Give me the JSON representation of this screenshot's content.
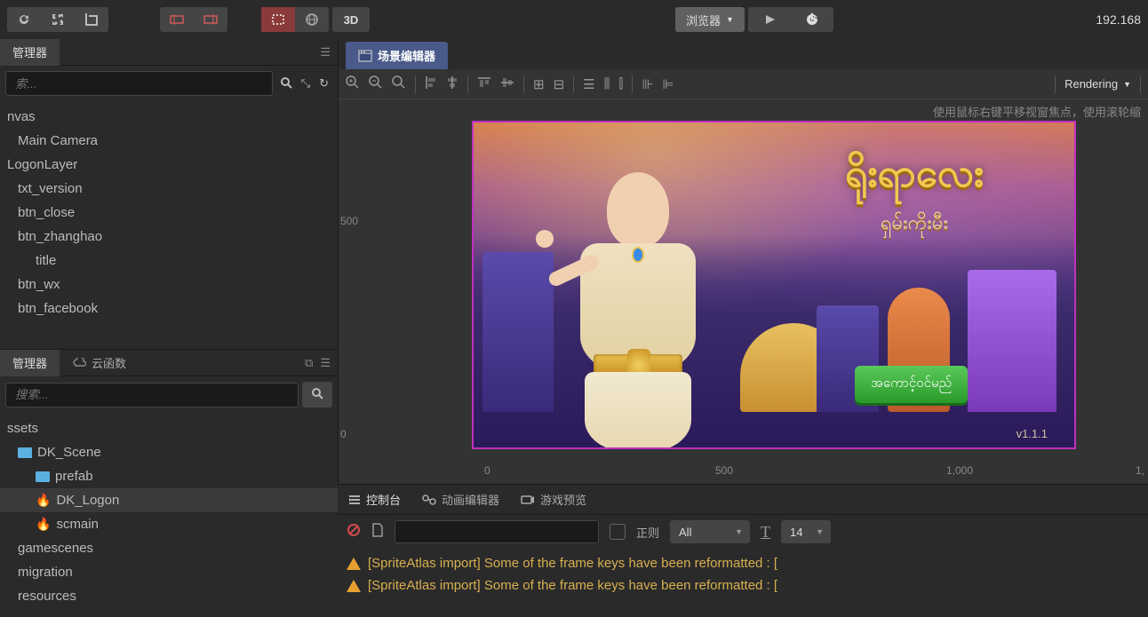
{
  "toolbar": {
    "dropdown_label": "浏览器",
    "btn_3d": "3D",
    "ip_text": "192.168"
  },
  "hierarchy": {
    "tab_label": "管理器",
    "search_placeholder": "索...",
    "items": [
      {
        "label": "nvas",
        "indent": 0
      },
      {
        "label": "Main Camera",
        "indent": 1
      },
      {
        "label": "LogonLayer",
        "indent": 0
      },
      {
        "label": "txt_version",
        "indent": 1
      },
      {
        "label": "btn_close",
        "indent": 1
      },
      {
        "label": "btn_zhanghao",
        "indent": 1
      },
      {
        "label": "title",
        "indent": 2
      },
      {
        "label": "btn_wx",
        "indent": 1
      },
      {
        "label": "btn_facebook",
        "indent": 1
      }
    ]
  },
  "assets": {
    "tab_label": "管理器",
    "tab2_label": "云函数",
    "search_placeholder": "搜索...",
    "items": [
      {
        "label": "ssets",
        "icon": "none",
        "indent": 0,
        "selected": false
      },
      {
        "label": "DK_Scene",
        "icon": "folder",
        "indent": 1,
        "selected": false
      },
      {
        "label": "prefab",
        "icon": "folder",
        "indent": 2,
        "selected": false
      },
      {
        "label": "DK_Logon",
        "icon": "fire",
        "indent": 2,
        "selected": true
      },
      {
        "label": "scmain",
        "icon": "fire",
        "indent": 2,
        "selected": false
      },
      {
        "label": "gamescenes",
        "icon": "none",
        "indent": 1,
        "selected": false
      },
      {
        "label": "migration",
        "icon": "none",
        "indent": 1,
        "selected": false
      },
      {
        "label": "resources",
        "icon": "none",
        "indent": 1,
        "selected": false
      }
    ]
  },
  "scene": {
    "tab_label": "场景编辑器",
    "rendering_label": "Rendering",
    "hint": "使用鼠标右键平移视窗焦点，使用滚轮缩",
    "ruler_v": [
      "500",
      "0"
    ],
    "ruler_h": [
      "0",
      "500",
      "1,000",
      "1,"
    ]
  },
  "game": {
    "logo_main": "ရိုးရာလေး",
    "logo_sub": "ရှမ်းကိုးမီး",
    "green_btn": "အကောင့်ဝင်မည်",
    "version": "v1.1.1"
  },
  "console": {
    "tabs": [
      "控制台",
      "动画编辑器",
      "游戏预览"
    ],
    "regex_label": "正则",
    "filter_label": "All",
    "font_size": "14",
    "logs": [
      "[SpriteAtlas import] Some of the frame keys have been reformatted : [",
      "[SpriteAtlas import] Some of the frame keys have been reformatted : ["
    ]
  }
}
